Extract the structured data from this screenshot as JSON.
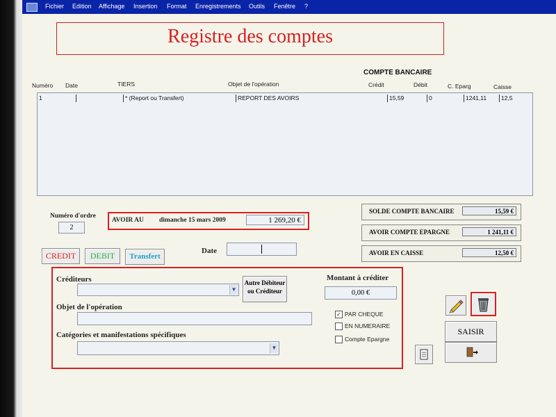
{
  "menu": [
    "Fichier",
    "Edition",
    "Affichage",
    "Insertion",
    "Format",
    "Enregistrements",
    "Outils",
    "Fenêtre",
    "?"
  ],
  "title": "Registre des comptes",
  "table": {
    "group_header": "COMPTE   BANCAIRE",
    "columns": [
      "Numéro",
      "Date",
      "TIERS",
      "Objet de l'opération",
      "Crédit",
      "Débit",
      "C. Eparg",
      "Caisse"
    ],
    "rows": [
      {
        "numero": "1",
        "date": "",
        "tiers": "* (Report ou Transfert)",
        "objet": "REPORT DES AVOIRS",
        "credit": "15,59",
        "debit": "0",
        "cepargne": "1241,11",
        "caisse": "12,5"
      }
    ]
  },
  "order": {
    "label": "Numéro d'ordre",
    "value": "2"
  },
  "avoir": {
    "label": "AVOIR AU",
    "date_text": "dimanche 15 mars 2009",
    "amount": "1 269,20 €"
  },
  "summary": [
    {
      "label": "SOLDE COMPTE BANCAIRE",
      "value": "15,59 €"
    },
    {
      "label": "AVOIR COMPTE EPARGNE",
      "value": "1 241,11 €"
    },
    {
      "label": "AVOIR EN CAISSE",
      "value": "12,50 €"
    }
  ],
  "mode_buttons": {
    "credit": "CREDIT",
    "debit": "DEBIT",
    "transfert": "Transfert"
  },
  "colors": {
    "credit": "#e02020",
    "debit": "#20b040",
    "transfert": "#20a0c8",
    "accent_red": "#d82020",
    "menubar": "#0a24a8"
  },
  "date_label": "Date",
  "form": {
    "crediteurs_label": "Créditeurs",
    "autre_button": "Autre Débiteur ou Créditeur",
    "montant_label": "Montant à créditer",
    "montant_value": "0,00 €",
    "objet_label": "Objet de l'opération",
    "categories_label": "Catégories et manifestations spécifiques",
    "checkboxes": [
      {
        "label": "PAR CHEQUE",
        "checked": true
      },
      {
        "label": "EN NUMERAIRE",
        "checked": false
      },
      {
        "label": "Compte Epargne",
        "checked": false
      }
    ]
  },
  "actions": {
    "saisir": "SAISIR"
  },
  "icons": {
    "edit": "pencil-icon",
    "delete": "trash-icon",
    "report": "document-icon",
    "exit": "exit-door-icon"
  }
}
